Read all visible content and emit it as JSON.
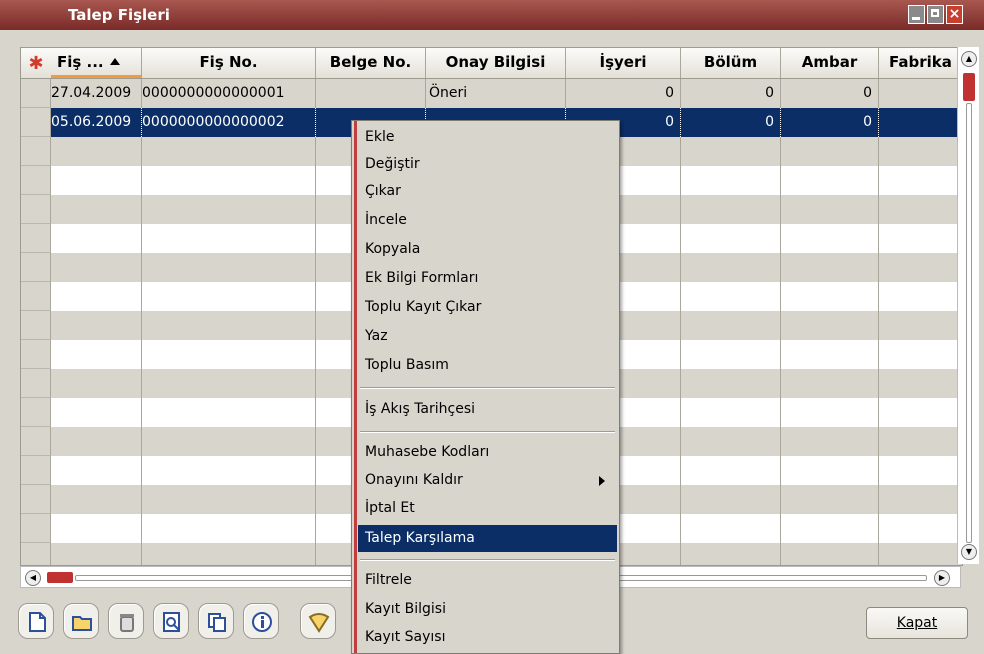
{
  "window": {
    "title": "Talep Fişleri"
  },
  "grid": {
    "columns": [
      {
        "label": "Fiş ..."
      },
      {
        "label": "Fiş No."
      },
      {
        "label": "Belge No."
      },
      {
        "label": "Onay Bilgisi"
      },
      {
        "label": "İşyeri"
      },
      {
        "label": "Bölüm"
      },
      {
        "label": "Ambar"
      },
      {
        "label": "Fabrika"
      }
    ],
    "rows": [
      {
        "date": "27.04.2009",
        "fis_no": "0000000000000001",
        "belge_no": "",
        "onay": "Öneri",
        "isyeri": "0",
        "bolum": "0",
        "ambar": "0",
        "fabrika": ""
      },
      {
        "date": "05.06.2009",
        "fis_no": "0000000000000002",
        "belge_no": "",
        "onay": "",
        "isyeri": "0",
        "bolum": "0",
        "ambar": "0",
        "fabrika": ""
      }
    ]
  },
  "context_menu": {
    "items": [
      "Ekle",
      "Değiştir",
      "Çıkar",
      "İncele",
      "Kopyala",
      "Ek Bilgi Formları",
      "Toplu Kayıt Çıkar",
      "Yaz",
      "Toplu Basım",
      "İş Akış Tarihçesi",
      "Muhasebe Kodları",
      "Onayını Kaldır",
      "İptal Et",
      "Talep Karşılama",
      "Filtrele",
      "Kayıt Bilgisi",
      "Kayıt Sayısı"
    ],
    "active_item": "Talep Karşılama"
  },
  "footer": {
    "close_label": "Kapat"
  },
  "colors": {
    "title_bar": "#8c3a35",
    "selection": "#0c2e66",
    "accent": "#c03131"
  }
}
